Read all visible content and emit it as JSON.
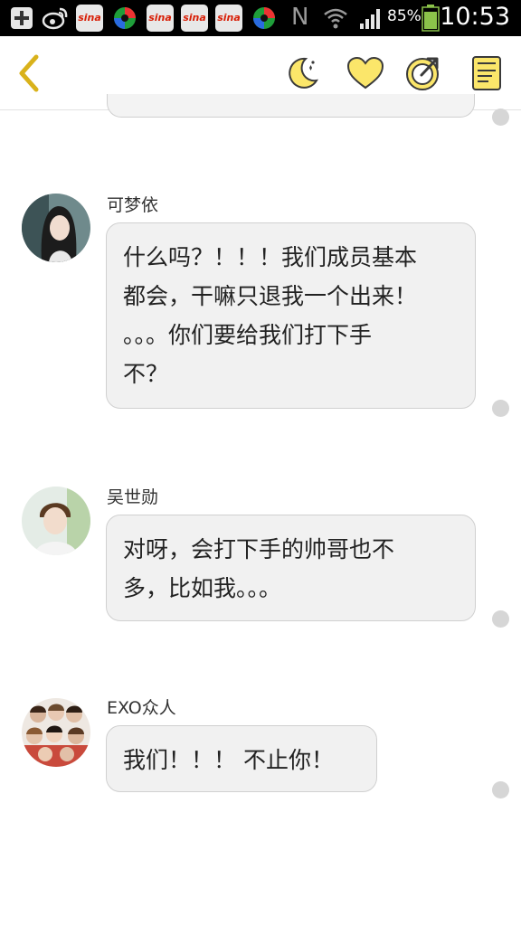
{
  "status_bar": {
    "battery_percent": "85%",
    "time": "10:53",
    "icons": [
      "plus-icon",
      "weibo-icon",
      "sina-news-icon",
      "color-ball-icon",
      "sina-news-icon",
      "sina-news-icon",
      "sina-news-icon",
      "color-ball-icon",
      "nfc-icon",
      "wifi-icon",
      "signal-icon",
      "battery-icon"
    ],
    "sina_label": "sina",
    "nfc_label": "N"
  },
  "toolbar": {
    "back_icon": "chevron-left-icon",
    "night_mode_icon": "moon-icon",
    "favorite_icon": "heart-icon",
    "share_icon": "share-icon",
    "notes_icon": "notebook-icon",
    "accent_color": "#f5c518"
  },
  "messages": [
    {
      "sender": "可梦依",
      "lines": [
        "什么吗？！！！我们成员基本",
        "都会，干嘛只退我一个出来！",
        "。。。你们要给我们打下手",
        "不？"
      ]
    },
    {
      "sender": "吴世勋",
      "lines": [
        "对呀，会打下手的帅哥也不",
        "多，比如我。。。"
      ]
    },
    {
      "sender": "EXO众人",
      "lines": [
        "我们！！！ 不止你！"
      ]
    }
  ]
}
